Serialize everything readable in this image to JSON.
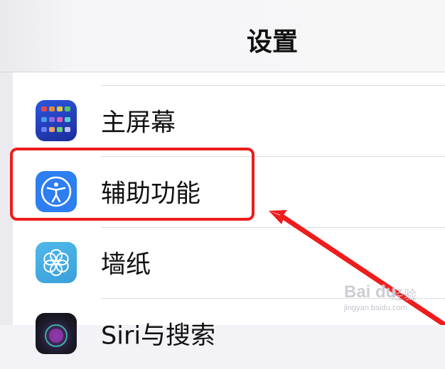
{
  "nav": {
    "title": "设置"
  },
  "rows": [
    {
      "label": "主屏幕",
      "icon": "home-screen-icon"
    },
    {
      "label": "辅助功能",
      "icon": "accessibility-icon"
    },
    {
      "label": "墙纸",
      "icon": "wallpaper-icon"
    },
    {
      "label": "Siri与搜索",
      "icon": "siri-icon"
    }
  ],
  "watermark": {
    "brand": "Bai du",
    "cn": "经验",
    "url": "jingyan.baidu.com"
  },
  "colors": {
    "highlight": "#ee1c1c",
    "accent": "#2d7ef0"
  }
}
